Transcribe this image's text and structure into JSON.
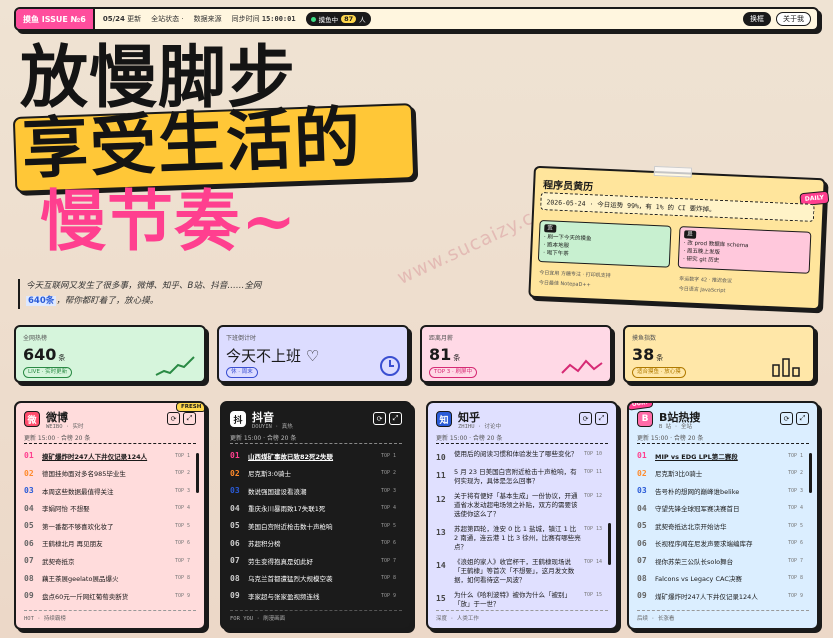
{
  "topbar": {
    "issue": "摸鱼 ISSUE №6",
    "date": "05/24",
    "update": "更新",
    "status": "全站状态",
    "sep": "·",
    "source": "数据来源",
    "sync_label": "同步时间",
    "sync_time": "15:00:01",
    "live_label": "摸鱼中",
    "live_count": "87",
    "live_unit": "人",
    "btn_dark": "换框",
    "btn_about": "关于我"
  },
  "hero": {
    "line1": "放慢脚步",
    "line2": "享受生活的",
    "line3": "慢节奏~",
    "subtitle_pre": "今天互联网又发生了很多事，微博、知乎、B站、抖音……全网",
    "subtitle_count": "640条",
    "subtitle_post": "，帮你都盯着了，放心摸。"
  },
  "watermark": "www.sucaizy.com",
  "diary": {
    "title": "程序员黄历",
    "badge": "DAILY",
    "line": "2026-05-24 · 今日运势 99%，有 1% 的 CI 要炸掉。",
    "good_tag": "宜",
    "good": [
      "· 刷一下今天的摸鱼",
      "· 跑本地服",
      "· 喝下午茶"
    ],
    "bad_tag": "忌",
    "bad": [
      "· 改 prod 数据库 schema",
      "· 周五晚上发版",
      "· 研究 git 历史"
    ],
    "foot_left_a": "今日宜用  方糖专注  ·  打印机支持",
    "foot_left_b": "今日最佳 NotepaD++",
    "foot_right_a": "幸运数字  42  ·  推迟会议",
    "foot_right_b": "今日语言 JavaScript"
  },
  "stats": [
    {
      "label": "全网热榜",
      "value": "640",
      "unit": "条",
      "chip": "LIVE · 实时更新"
    },
    {
      "label": "下班倒计时",
      "value": "今天不上班 ♡",
      "chip": "休 · 周末"
    },
    {
      "label": "距离月薪",
      "value": "81",
      "unit": "条",
      "chip": "TOP 3 · 刷屏中"
    },
    {
      "label": "摸鱼指数",
      "value": "38",
      "unit": "条",
      "chip": "适合摸鱼 · 放心摸"
    }
  ],
  "panels": {
    "weibo": {
      "logo": "微",
      "name": "微博",
      "sub": "WEIBO · 实时",
      "meta": "更新 15:00 · 合榜 20 条",
      "flag": "FRESH",
      "foot": "HOT · 持续霸榜",
      "items": [
        {
          "rank": "01",
          "text": "摸矿爆炸时247人下井仅记录124人",
          "top": "TOP 1"
        },
        {
          "rank": "02",
          "text": "德国挂帅面对多名985毕业生",
          "top": "TOP 2"
        },
        {
          "rank": "03",
          "text": "本周这些数据最值得关注",
          "top": "TOP 3"
        },
        {
          "rank": "04",
          "text": "李娟阿怡 不想娶",
          "top": "TOP 4"
        },
        {
          "rank": "05",
          "text": "第一番都不够喜欢化妆了",
          "top": "TOP 5"
        },
        {
          "rank": "06",
          "text": "王鹤棣北月 再见朋友",
          "top": "TOP 6"
        },
        {
          "rank": "07",
          "text": "武契奇抵京",
          "top": "TOP 7"
        },
        {
          "rank": "08",
          "text": "藕王茶展geelato展品爆火",
          "top": "TOP 8"
        },
        {
          "rank": "09",
          "text": "盘点60元一斤网红葡萄卖断货",
          "top": "TOP 9"
        }
      ]
    },
    "douyin": {
      "logo": "抖",
      "name": "抖音",
      "sub": "DOUYIN · 真热",
      "meta": "更新 15:00 · 合榜 20 条",
      "foot": "FOR YOU · 刷漫画面",
      "items": [
        {
          "rank": "01",
          "text": "山西煤矿事故已致82死2失联",
          "top": "TOP 1"
        },
        {
          "rank": "02",
          "text": "尼克斯3:0骑士",
          "top": "TOP 2"
        },
        {
          "rank": "03",
          "text": "数说强国建设看浪潮",
          "top": "TOP 3"
        },
        {
          "rank": "04",
          "text": "重庆永川暴雨致17失联1死",
          "top": "TOP 4"
        },
        {
          "rank": "05",
          "text": "美国白宫附近枪击数十声枪响",
          "top": "TOP 5"
        },
        {
          "rank": "06",
          "text": "苏超积分榜",
          "top": "TOP 6"
        },
        {
          "rank": "07",
          "text": "劳生变得抱真是如此好",
          "top": "TOP 7"
        },
        {
          "rank": "08",
          "text": "乌克兰首都遭猛烈大规模空袭",
          "top": "TOP 8"
        },
        {
          "rank": "09",
          "text": "李家超与张家盈视频连线",
          "top": "TOP 9"
        }
      ]
    },
    "zhihu": {
      "logo": "知",
      "name": "知乎",
      "sub": "ZHIHU · 讨论中",
      "meta": "更新 15:00 · 合榜 20 条",
      "foot": "深度 · 人类工作",
      "items": [
        {
          "rank": "10",
          "text": "使用后的阅读习惯和体验发生了哪些变化？",
          "top": "TOP 10"
        },
        {
          "rank": "11",
          "text": "5 月 23 日美国白宫附近枪击十声枪响，有何实现为，具体是怎么回事？",
          "top": "TOP 11"
        },
        {
          "rank": "12",
          "text": "关于将有便好「基本生成」一份协议，开通道省水发动超电场领之补贴，双方的需要该选使你这么了？",
          "top": "TOP 12"
        },
        {
          "rank": "13",
          "text": "苏超第四轮，淮安 0 比 1 盐城，镇江 1 比 2 南通，连云港 1 比 3 徐州，比赛有哪些亮点？",
          "top": "TOP 13"
        },
        {
          "rank": "14",
          "text": "《浪姐的家人》收官杯干，王鹤棣现场说「王鹤棣」等首次「不想娶」，这月发文数据，如何看待这一风波？",
          "top": "TOP 14"
        },
        {
          "rank": "15",
          "text": "为什么《哈利波特》被你为什么「被别」「放」于一世？",
          "top": "TOP 15"
        }
      ]
    },
    "bilibili": {
      "logo": "B",
      "name": "B站热搜",
      "sub": "B 站 · 全站",
      "meta": "更新 15:00 · 合榜 20 条",
      "flag": "OUR!",
      "foot": "后续 · 长涨看",
      "items": [
        {
          "rank": "01",
          "text": "MIP vs EDG LPL第二赛段",
          "top": "TOP 1"
        },
        {
          "rank": "02",
          "text": "尼克斯3比0骑士",
          "top": "TOP 2"
        },
        {
          "rank": "03",
          "text": "告号朴的想网的巅峰谁belike",
          "top": "TOP 3"
        },
        {
          "rank": "04",
          "text": "守望先锋全球冠军赛决赛首日",
          "top": "TOP 4"
        },
        {
          "rank": "05",
          "text": "武契奇抵达北京开始访华",
          "top": "TOP 5"
        },
        {
          "rank": "06",
          "text": "长视程序闻在尼发声要求端编库存",
          "top": "TOP 6"
        },
        {
          "rank": "07",
          "text": "视你苏荣三公队长solo舞台",
          "top": "TOP 7"
        },
        {
          "rank": "08",
          "text": "Falcons vs Legacy CAC决赛",
          "top": "TOP 8"
        },
        {
          "rank": "09",
          "text": "煤矿爆炸时247人下井仅记录124人",
          "top": "TOP 9"
        }
      ]
    }
  },
  "colors": {
    "weibo": "#ffd6d6",
    "douyin": "#1b1b1b",
    "zhihu": "#dcdcff",
    "bilibili": "#d9eeff",
    "pink": "#ff3f8f",
    "yellow": "#ffc737"
  }
}
